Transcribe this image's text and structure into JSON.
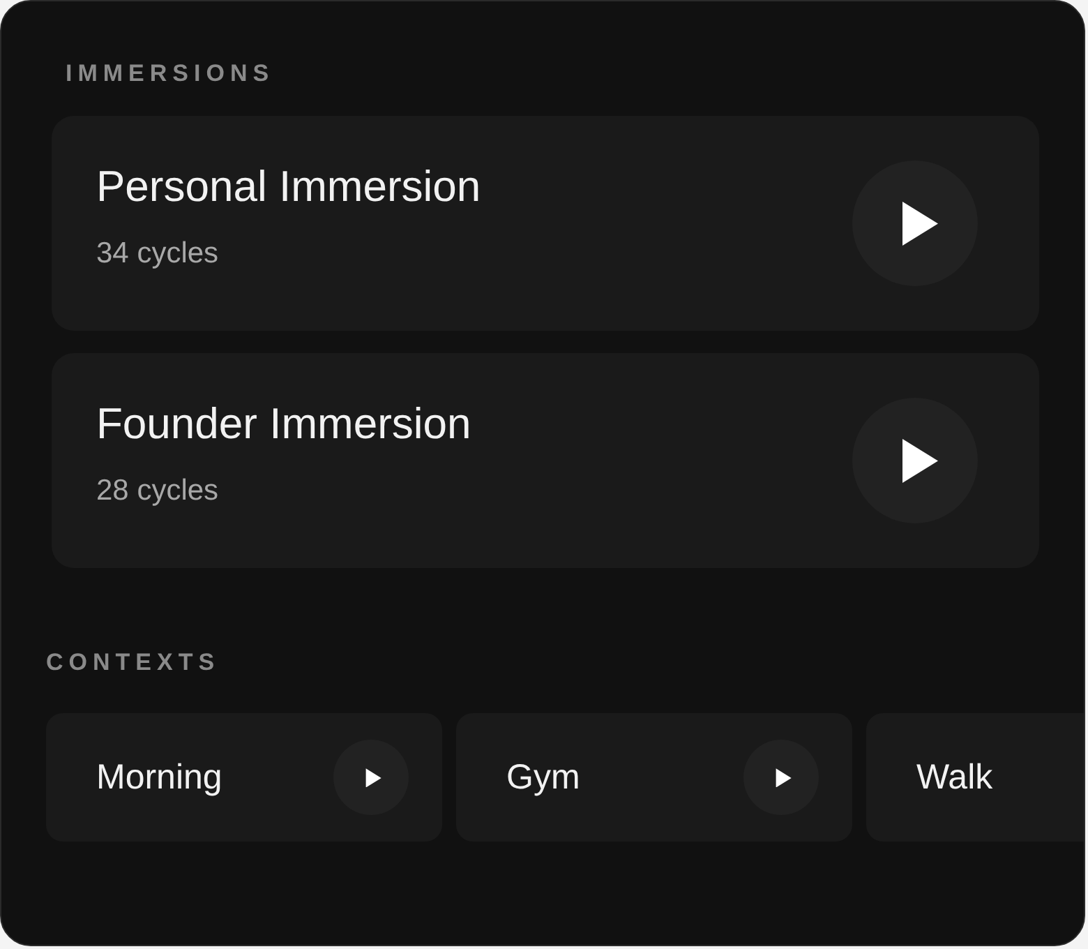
{
  "immersions": {
    "heading": "IMMERSIONS",
    "items": [
      {
        "title": "Personal Immersion",
        "subtitle": "34 cycles"
      },
      {
        "title": "Founder Immersion",
        "subtitle": "28 cycles"
      }
    ]
  },
  "contexts": {
    "heading": "CONTEXTS",
    "items": [
      {
        "label": "Morning"
      },
      {
        "label": "Gym"
      },
      {
        "label": "Walk"
      }
    ]
  }
}
